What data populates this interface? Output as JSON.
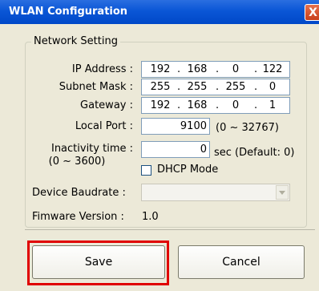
{
  "window": {
    "title": "WLAN Configuration",
    "close_glyph": "X"
  },
  "network": {
    "group_label": "Network Setting",
    "ip_label": "IP Address :",
    "ip": [
      "192",
      "168",
      "0",
      "122"
    ],
    "subnet_label": "Subnet Mask :",
    "subnet": [
      "255",
      "255",
      "255",
      "0"
    ],
    "gateway_label": "Gateway :",
    "gateway": [
      "192",
      "168",
      "0",
      "1"
    ],
    "port_label": "Local Port :",
    "port_value": "9100",
    "port_range": "(0 ~ 32767)",
    "inactivity_label": "Inactivity time :",
    "inactivity_range": "(0 ~ 3600)",
    "inactivity_value": "0",
    "inactivity_unit": "sec (Default: 0)",
    "dhcp_label": "DHCP Mode",
    "dhcp_checked": false,
    "baudrate_label": "Device Baudrate :",
    "baudrate_value": "",
    "firmware_label": "Fimware Version :",
    "firmware_value": "1.0"
  },
  "buttons": {
    "save": "Save",
    "cancel": "Cancel"
  },
  "colors": {
    "titlebar": "#0a56d6",
    "dialog_bg": "#ece9d8",
    "highlight": "#e00000"
  },
  "icons": {
    "close": "close-icon",
    "dropdown": "chevron-down-icon"
  }
}
